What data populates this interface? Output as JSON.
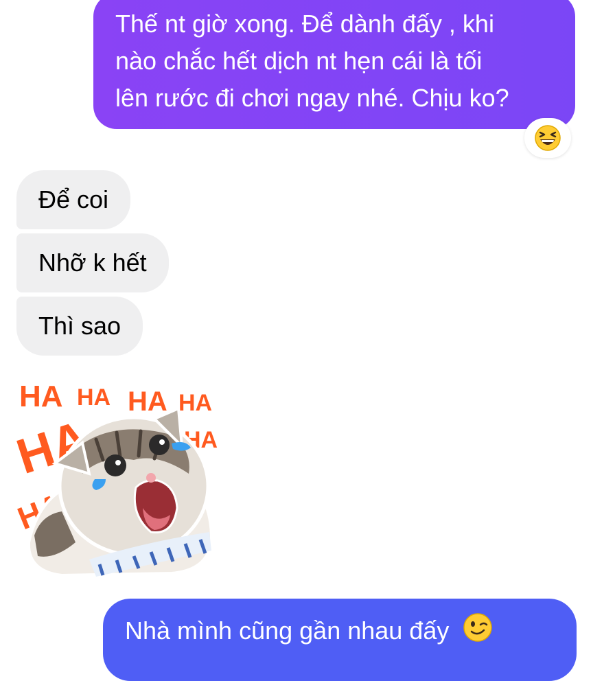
{
  "messages": {
    "outgoing_1": {
      "lines": [
        "Thế nt giờ xong. Để dành đấy , khi",
        "nào chắc hết dịch nt hẹn cái là tối",
        "lên rước đi chơi ngay nhé. Chịu ko?"
      ],
      "reaction": "laughing-squint-emoji"
    },
    "incoming": [
      {
        "text": "Để coi"
      },
      {
        "text": "Nhỡ k hết"
      },
      {
        "text": "Thì sao"
      }
    ],
    "sticker": {
      "icon": "laughing-cat-sticker",
      "words": [
        "HA",
        "HA",
        "HA",
        "HA",
        "HA",
        "HA",
        "HA"
      ]
    },
    "outgoing_2": {
      "text": "Nhà mình cũng gần nhau đấy",
      "emoji": "winking-emoji"
    }
  },
  "colors": {
    "outgoing_1_bubble": "#8a43f5",
    "outgoing_2_bubble": "#4f5ef5",
    "incoming_bubble": "#efeff0",
    "sticker_text": "#ff5a1f"
  }
}
